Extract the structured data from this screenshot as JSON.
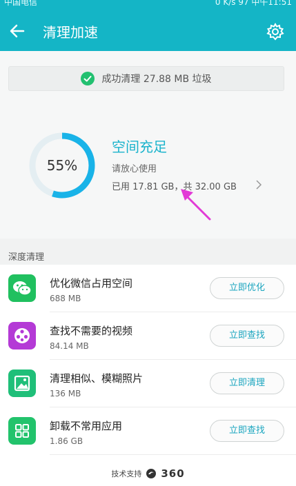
{
  "status_bar": {
    "carrier": "中国电信",
    "right": "0 K/s  97  中午11:51"
  },
  "header": {
    "title": "清理加速"
  },
  "banner": {
    "text": "成功清理 27.88 MB 垃圾"
  },
  "storage": {
    "percent_label": "55%",
    "percent": 55,
    "title": "空间充足",
    "subtitle": "请放心使用",
    "usage": "已用 17.81 GB，共 32.00 GB"
  },
  "section": {
    "title": "深度清理"
  },
  "items": [
    {
      "title": "优化微信占用空间",
      "size": "688 MB",
      "button": "立即优化",
      "color": "#20c05f"
    },
    {
      "title": "查找不需要的视频",
      "size": "84.14 MB",
      "button": "立即查找",
      "color": "#b43ad6"
    },
    {
      "title": "清理相似、模糊照片",
      "size": "136 MB",
      "button": "立即清理",
      "color": "#1fbf79"
    },
    {
      "title": "卸载不常用应用",
      "size": "1.86 GB",
      "button": "立即查找",
      "color": "#22c36c"
    }
  ],
  "footer": {
    "text": "技术支持",
    "brand": "360"
  },
  "colors": {
    "accent": "#14b5c6",
    "ring": "#19b3e8",
    "arrow": "#e23ad6"
  }
}
